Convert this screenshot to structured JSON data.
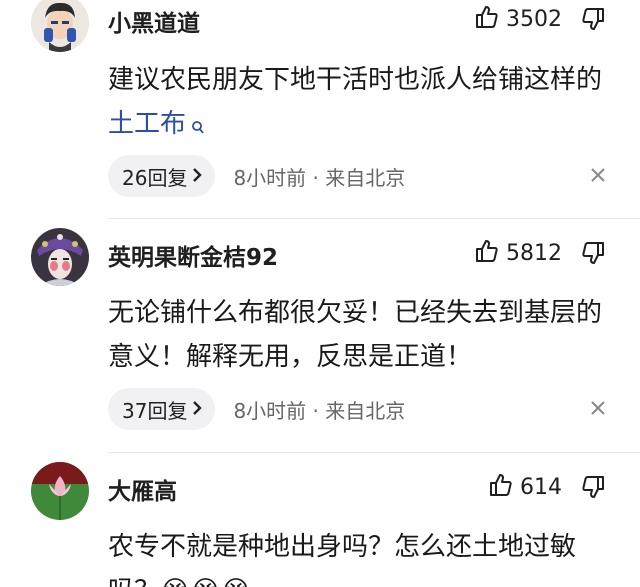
{
  "comments": [
    {
      "username": "小黑道道",
      "likes": "3502",
      "text_before_link": "建议农民朋友下地干活时也派人给铺这样的",
      "link_text": "土工布",
      "replies_label": "26回复",
      "meta": "8小时前 · 来自北京"
    },
    {
      "username": "英明果断金桔92",
      "likes": "5812",
      "text": "无论铺什么布都很欠妥！已经失去到基层的意义！解释无用，反思是正道！",
      "replies_label": "37回复",
      "meta": "8小时前 · 来自北京"
    },
    {
      "username": "大雁高",
      "likes": "614",
      "text": "农专不就是种地出身吗？怎么还土地过敏吗？",
      "emoji": "😭😭😭"
    }
  ],
  "icons": {
    "like": "thumbs-up-icon",
    "dislike": "thumbs-down-icon",
    "search": "search-icon",
    "close": "close-icon",
    "chevron": "chevron-right-icon"
  },
  "colors": {
    "link": "#2d4ea8",
    "pill_bg": "#f1f1f3",
    "meta": "#666666"
  }
}
